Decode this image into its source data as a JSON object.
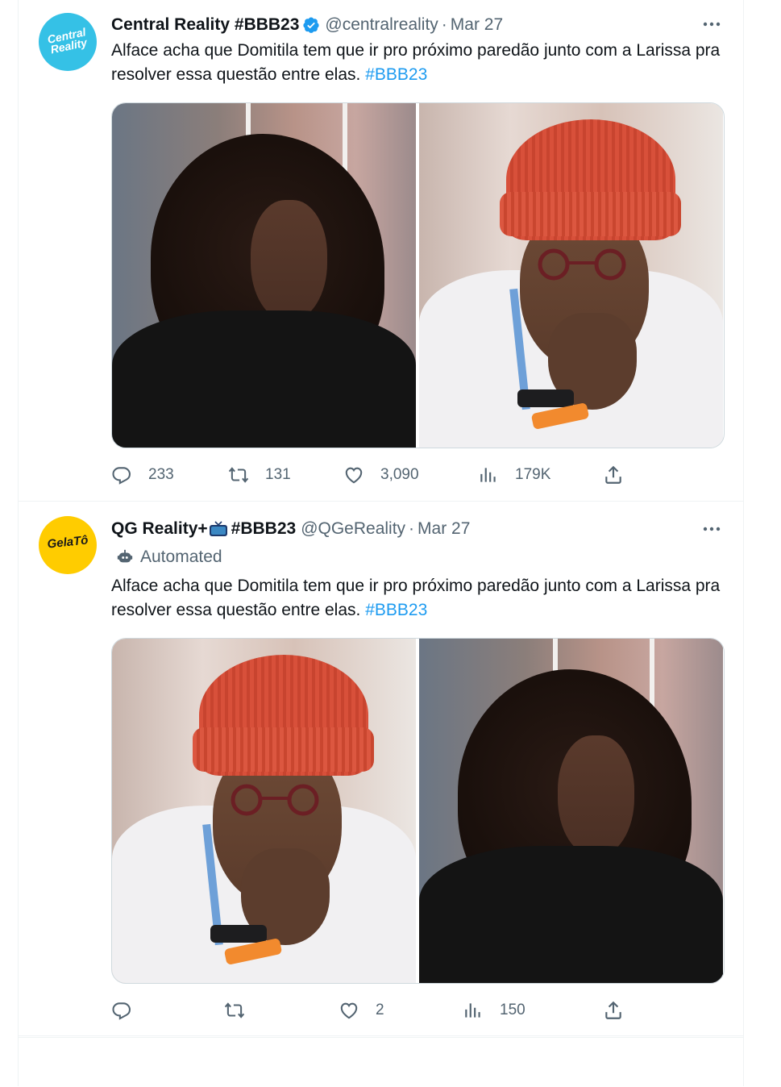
{
  "tweets": [
    {
      "avatar_text": "Central Reality",
      "name": "Central Reality #BBB23",
      "handle": "@centralreality",
      "separator": "·",
      "date": "Mar 27",
      "text": "Alface acha que Domitila tem que ir pro próximo paredão junto com a Larissa pra resolver essa questão entre elas.",
      "hashtag": "#BBB23",
      "actions": {
        "replies": "233",
        "retweets": "131",
        "likes": "3,090",
        "views": "179K"
      }
    },
    {
      "avatar_text": "GelaTô",
      "name": "QG Reality+",
      "name_suffix": "#BBB23",
      "handle": "@QGeReality",
      "separator": "·",
      "date": "Mar 27",
      "automated_label": "Automated",
      "text": "Alface acha que Domitila tem que ir pro próximo paredão junto com a Larissa pra resolver essa questão entre elas.",
      "hashtag": "#BBB23",
      "actions": {
        "replies": "",
        "retweets": "",
        "likes": "2",
        "views": "150"
      }
    }
  ],
  "colors": {
    "accent": "#1d9bf0",
    "muted": "#536471",
    "text": "#0f1419",
    "border": "#eff3f4"
  }
}
